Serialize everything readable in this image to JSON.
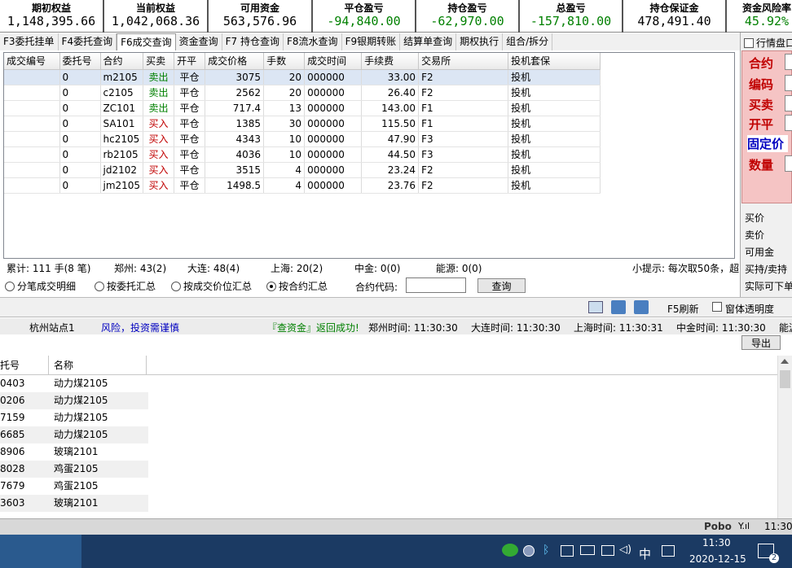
{
  "summary": [
    {
      "label": "期初权益",
      "value": "1,148,395.66",
      "color": "#000000"
    },
    {
      "label": "当前权益",
      "value": "1,042,068.36",
      "color": "#000000"
    },
    {
      "label": "可用资金",
      "value": "563,576.96",
      "color": "#000000"
    },
    {
      "label": "平仓盈亏",
      "value": "-94,840.00",
      "color": "#008000"
    },
    {
      "label": "持仓盈亏",
      "value": "-62,970.00",
      "color": "#008000"
    },
    {
      "label": "总盈亏",
      "value": "-157,810.00",
      "color": "#008000"
    },
    {
      "label": "持仓保证金",
      "value": "478,491.40",
      "color": "#000000"
    },
    {
      "label": "资金风险率",
      "value": "45.92%",
      "color": "#008000"
    }
  ],
  "tabs": [
    "F3委托挂单",
    "F4委托查询",
    "F6成交查询",
    "资金查询",
    "F7 持仓查询",
    "F8流水查询",
    "F9银期转账",
    "结算单查询",
    "期权执行",
    "组合/拆分"
  ],
  "active_tab": 2,
  "grid": {
    "columns": [
      "成交编号",
      "委托号",
      "合约",
      "买卖",
      "开平",
      "成交价格",
      "手数",
      "成交时间",
      "手续费",
      "交易所",
      "投机套保"
    ],
    "rows": [
      [
        "",
        "0",
        "m2105",
        "卖出",
        "平仓",
        "3075",
        "20",
        "000000",
        "33.00",
        "F2",
        "投机"
      ],
      [
        "",
        "0",
        "c2105",
        "卖出",
        "平仓",
        "2562",
        "20",
        "000000",
        "26.40",
        "F2",
        "投机"
      ],
      [
        "",
        "0",
        "ZC101",
        "卖出",
        "平仓",
        "717.4",
        "13",
        "000000",
        "143.00",
        "F1",
        "投机"
      ],
      [
        "",
        "0",
        "SA101",
        "买入",
        "平仓",
        "1385",
        "30",
        "000000",
        "115.50",
        "F1",
        "投机"
      ],
      [
        "",
        "0",
        "hc2105",
        "买入",
        "平仓",
        "4343",
        "10",
        "000000",
        "47.90",
        "F3",
        "投机"
      ],
      [
        "",
        "0",
        "rb2105",
        "买入",
        "平仓",
        "4036",
        "10",
        "000000",
        "44.50",
        "F3",
        "投机"
      ],
      [
        "",
        "0",
        "jd2102",
        "买入",
        "平仓",
        "3515",
        "4",
        "000000",
        "23.24",
        "F2",
        "投机"
      ],
      [
        "",
        "0",
        "jm2105",
        "买入",
        "平仓",
        "1498.5",
        "4",
        "000000",
        "23.76",
        "F2",
        "投机"
      ]
    ]
  },
  "stats": {
    "total": "累计: 111 手(8 笔)",
    "zhengzhou": "郑州: 43(2)",
    "dalian": "大连: 48(4)",
    "shanghai": "上海: 20(2)",
    "zhongjin": "中金: 0(0)",
    "nengyuan": "能源: 0(0)",
    "tip": "小提示: 每次取50条，超"
  },
  "options": {
    "radios": [
      "分笔成交明细",
      "按委托汇总",
      "按成交价位汇总",
      "按合约汇总"
    ],
    "selected": 3,
    "code_label": "合约代码:",
    "code_value": "",
    "query_button": "查询"
  },
  "right_panel": {
    "checkbox_label": "行情盘口",
    "labels": [
      "合约",
      "编码",
      "买卖",
      "开平",
      "固定价",
      "数量"
    ],
    "quote_labels": [
      "买价",
      "卖价",
      "可用金",
      "买持/卖持",
      "实际可下单"
    ]
  },
  "toolbar": {
    "refresh": "F5刷新",
    "transparency": "窗体透明度"
  },
  "status": {
    "site": "杭州站点1",
    "risk": "风险，投资需谨慎",
    "result": "『查资金』返回成功!",
    "zz_time": "郑州时间: 11:30:30",
    "dl_time": "大连时间: 11:30:30",
    "sh_time": "上海时间: 11:30:31",
    "zj_time": "中金时间: 11:30:30",
    "ny": "能源"
  },
  "lower": {
    "export_button": "导出",
    "columns": [
      "委托号",
      "名称"
    ],
    "rows": [
      [
        "0403",
        "动力煤2105"
      ],
      [
        "0206",
        "动力煤2105"
      ],
      [
        "7159",
        "动力煤2105"
      ],
      [
        "6685",
        "动力煤2105"
      ],
      [
        "8906",
        "玻璃2101"
      ],
      [
        "8028",
        "鸡蛋2105"
      ],
      [
        "7679",
        "鸡蛋2105"
      ],
      [
        "3603",
        "玻璃2101"
      ]
    ]
  },
  "pobo": {
    "brand": "Pobo",
    "time": "11:30"
  },
  "taskbar": {
    "time": "11:30",
    "date": "2020-12-15",
    "ime": "中",
    "notif": "2"
  }
}
